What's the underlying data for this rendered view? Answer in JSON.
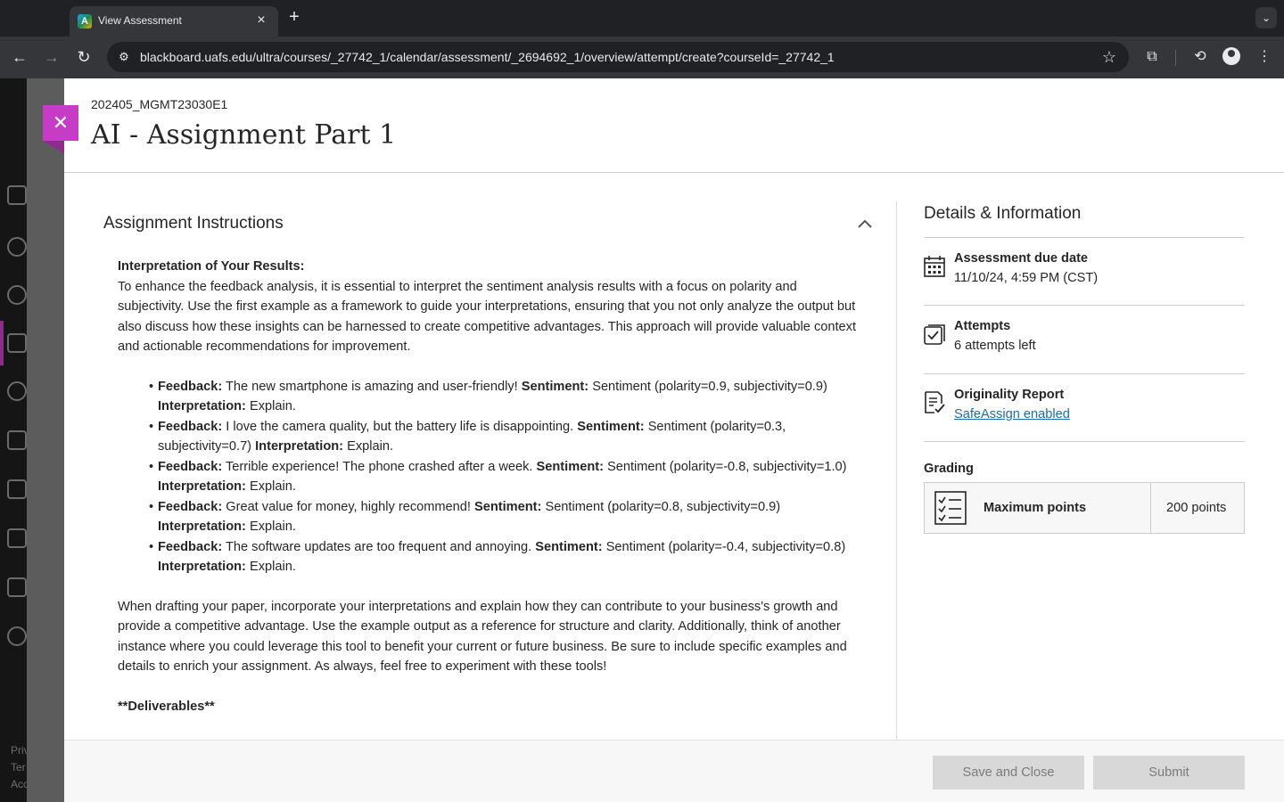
{
  "browser": {
    "tab_title": "View Assessment",
    "tab_favicon": "A",
    "url": "blackboard.uafs.edu/ultra/courses/_27742_1/calendar/assessment/_2694692_1/overview/attempt/create?courseId=_27742_1",
    "icons": {
      "back": "←",
      "forward": "→",
      "reload": "↻",
      "new_tab": "+",
      "close_tab": "×",
      "tab_search": "⌄",
      "site_info": "⚙",
      "bookmark": "☆",
      "extensions": "⧉",
      "menu": "⋮",
      "sync": "⟲"
    }
  },
  "behind": {
    "footer_lines": [
      "Priv",
      "Ter",
      "Acc"
    ]
  },
  "panel": {
    "close_glyph": "✕",
    "course_id": "202405_MGMT23030E1",
    "title": "AI - Assignment Part 1"
  },
  "instructions": {
    "heading": "Assignment Instructions",
    "interpretation_heading": "Interpretation of Your Results:",
    "intro": "To enhance the feedback analysis, it is essential to interpret the sentiment analysis results with a focus on polarity and subjectivity. Use the first example as a framework to guide your interpretations, ensuring that you not only analyze the output but also discuss how these insights can be harnessed to create competitive advantages. This approach will provide valuable context and actionable recommendations for improvement.",
    "labels": {
      "feedback": "Feedback:",
      "sentiment": "Sentiment:",
      "interpretation": "Interpretation:"
    },
    "items": [
      {
        "feedback": " The new smartphone is amazing and user-friendly! ",
        "sentiment": " Sentiment (polarity=0.9, subjectivity=0.9) ",
        "interpretation": " Explain."
      },
      {
        "feedback": " I love the camera quality, but the battery life is disappointing. ",
        "sentiment": " Sentiment (polarity=0.3, subjectivity=0.7) ",
        "interpretation": " Explain."
      },
      {
        "feedback": " Terrible experience! The phone crashed after a week. ",
        "sentiment": " Sentiment (polarity=-0.8, subjectivity=1.0) ",
        "interpretation": " Explain."
      },
      {
        "feedback": " Great value for money, highly recommend! ",
        "sentiment": " Sentiment (polarity=0.8, subjectivity=0.9) ",
        "interpretation": " Explain."
      },
      {
        "feedback": " The software updates are too frequent and annoying. ",
        "sentiment": " Sentiment (polarity=-0.4, subjectivity=0.8) ",
        "interpretation": " Explain."
      }
    ],
    "drafting": "When drafting your paper, incorporate your interpretations and explain how they can contribute to your business's growth and provide a competitive advantage. Use the example output as a reference for structure and clarity. Additionally, think of another instance where you could leverage this tool to benefit your current or future business. Be sure to include specific examples and details to enrich your assignment. As always, feel free to experiment with these tools!",
    "deliverables": "**Deliverables**"
  },
  "details": {
    "title": "Details & Information",
    "due": {
      "label": "Assessment due date",
      "value": "11/10/24, 4:59 PM (CST)"
    },
    "attempts": {
      "label": "Attempts",
      "value": "6 attempts left"
    },
    "originality": {
      "label": "Originality Report",
      "link": "SafeAssign enabled"
    },
    "grading": {
      "label": "Grading",
      "max_label": "Maximum points",
      "max_value": "200 points"
    }
  },
  "footer": {
    "save_label": "Save and Close",
    "submit_label": "Submit"
  }
}
